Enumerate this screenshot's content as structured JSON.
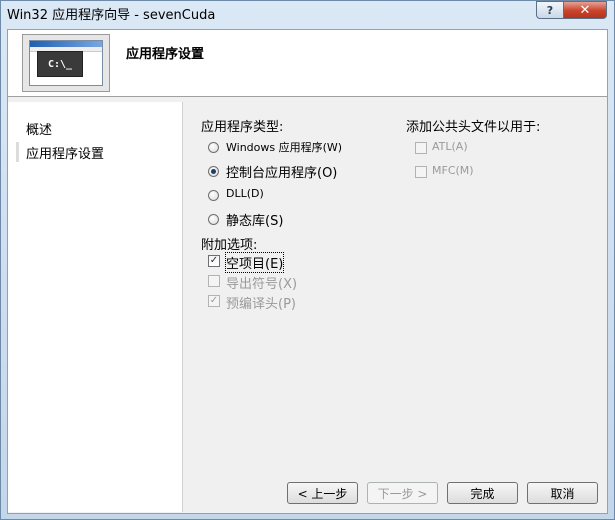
{
  "window": {
    "title": "Win32 应用程序向导 - sevenCuda",
    "help_glyph": "?",
    "close_glyph": "✕"
  },
  "header": {
    "banner_console_text": "C:\\_",
    "title": "应用程序设置"
  },
  "nav": {
    "items": [
      {
        "label": "概述"
      },
      {
        "label": "应用程序设置"
      }
    ]
  },
  "app_type": {
    "heading": "应用程序类型:",
    "options": [
      {
        "label": "Windows 应用程序(W)",
        "checked": false
      },
      {
        "label": "控制台应用程序(O)",
        "checked": true
      },
      {
        "label": "DLL(D)",
        "checked": false
      },
      {
        "label": "静态库(S)",
        "checked": false
      }
    ]
  },
  "extra_options": {
    "heading": "附加选项:",
    "items": [
      {
        "label": "空项目(E)",
        "checked": true,
        "enabled": true
      },
      {
        "label": "导出符号(X)",
        "checked": false,
        "enabled": false
      },
      {
        "label": "预编译头(P)",
        "checked": true,
        "enabled": false
      }
    ]
  },
  "common_headers": {
    "heading": "添加公共头文件以用于:",
    "items": [
      {
        "label": "ATL(A)",
        "checked": false,
        "enabled": false
      },
      {
        "label": "MFC(M)",
        "checked": false,
        "enabled": false
      }
    ]
  },
  "buttons": {
    "prev": "< 上一步",
    "next": "下一步 >",
    "finish": "完成",
    "cancel": "取消"
  },
  "check_glyph": "✓"
}
